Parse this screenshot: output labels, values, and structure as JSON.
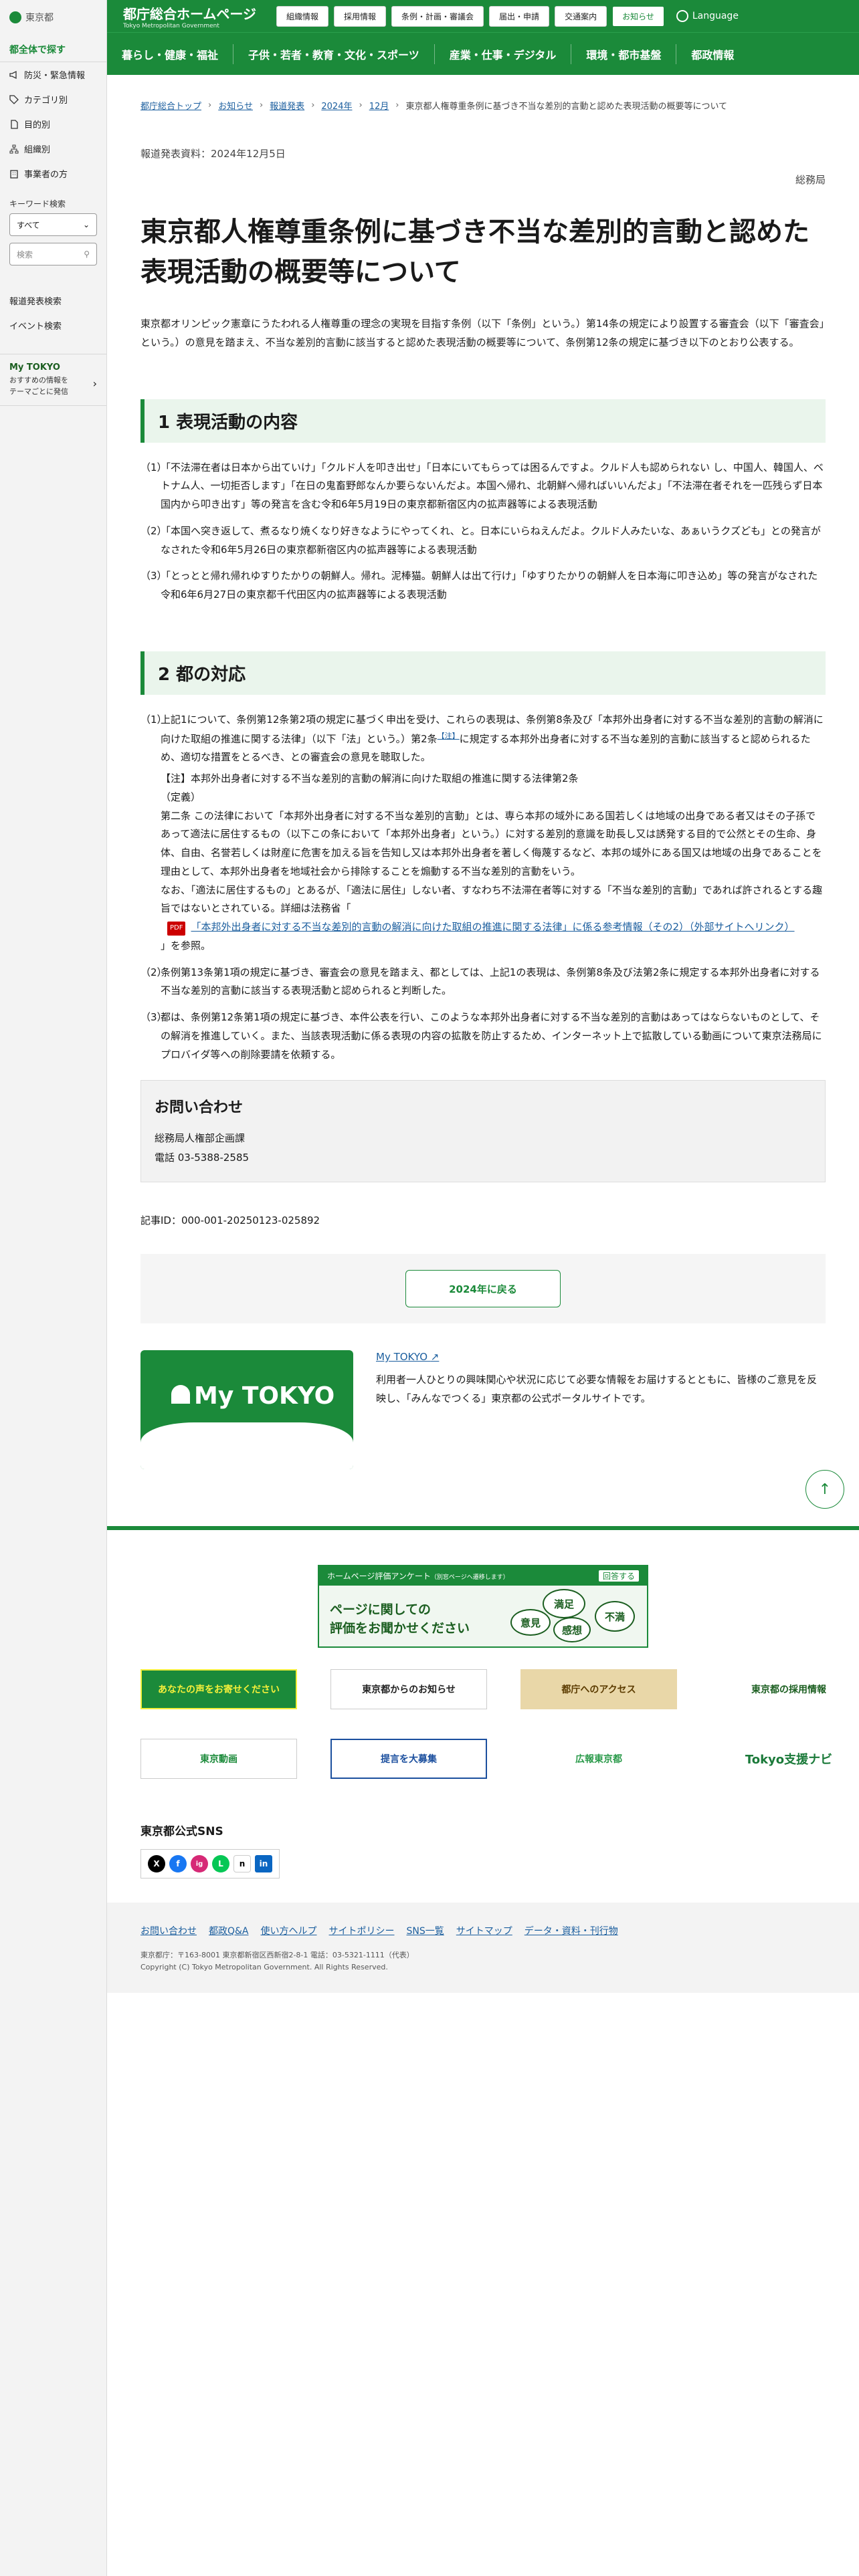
{
  "sidebar": {
    "logo": "東京都",
    "section_title": "都全体で探す",
    "items": [
      "防災・緊急情報",
      "カテゴリ別",
      "目的別",
      "組織別",
      "事業者の方"
    ],
    "keyword_label": "キーワード検索",
    "select_value": "すべて",
    "search_placeholder": "検索",
    "links": [
      "報道発表検索",
      "イベント検索"
    ],
    "mytokyo_title": "My TOKYO",
    "mytokyo_sub1": "おすすめの情報を",
    "mytokyo_sub2": "テーマごとに発信"
  },
  "header": {
    "title": "都庁総合ホームページ",
    "subtitle": "Tokyo Metropolitan Government",
    "top_links": [
      "組織情報",
      "採用情報",
      "条例・計画・審議会",
      "届出・申請",
      "交通案内",
      "お知らせ"
    ],
    "language": "Language",
    "nav": [
      "暮らし・健康・福祉",
      "子供・若者・教育・文化・スポーツ",
      "産業・仕事・デジタル",
      "環境・都市基盤",
      "都政情報"
    ]
  },
  "breadcrumb": [
    "都庁総合トップ",
    "お知らせ",
    "報道発表",
    "2024年",
    "12月",
    "東京都人権尊重条例に基づき不当な差別的言動と認めた表現活動の概要等について"
  ],
  "article": {
    "date": "報道発表資料：2024年12月5日",
    "bureau": "総務局",
    "title": "東京都人権尊重条例に基づき不当な差別的言動と認めた表現活動の概要等について",
    "lead": "東京都オリンピック憲章にうたわれる人権尊重の理念の実現を目指す条例（以下「条例」という。）第14条の規定により設置する審査会（以下「審査会」という。）の意見を踏まえ、不当な差別的言動に該当すると認めた表現活動の概要等について、条例第12条の規定に基づき以下のとおり公表する。",
    "section1": "1 表現活動の内容",
    "items1": [
      {
        "num": "（1）",
        "text": "「不法滞在者は日本から出ていけ」「クルド人を叩き出せ」「日本にいてもらっては困るんですよ。クルド人も認められない し、中国人、韓国人、ベトナム人、一切拒否します」「在日の鬼畜野郎なんか要らないんだよ。本国へ帰れ、北朝鮮へ帰ればいいんだよ」「不法滞在者それを一匹残らず日本国内から叩き出す」等の発言を含む令和6年5月19日の東京都新宿区内の拡声器等による表現活動"
      },
      {
        "num": "（2）",
        "text": "「本国へ突き返して、煮るなり焼くなり好きなようにやってくれ、と。日本にいらねえんだよ。クルド人みたいな、あぁいうクズども」との発言がなされた令和6年5月26日の東京都新宿区内の拡声器等による表現活動"
      },
      {
        "num": "（3）",
        "text": "「とっとと帰れ帰れゆすりたかりの朝鮮人。帰れ。泥棒猫。朝鮮人は出て行け」「ゆすりたかりの朝鮮人を日本海に叩き込め」等の発言がなされた令和6年6月27日の東京都千代田区内の拡声器等による表現活動"
      }
    ],
    "section2": "2 都の対応",
    "item2_1_num": "（1）",
    "item2_1_a": "上記1について、条例第12条第2項の規定に基づく申出を受け、これらの表現は、条例第8条及び「本邦外出身者に対する不当な差別的言動の解消に向けた取組の推進に関する法律」（以下「法」という。）第2条",
    "item2_1_ref": "【注】",
    "item2_1_b": "に規定する本邦外出身者に対する不当な差別的言動に該当すると認められるため、適切な措置をとるべき、との審査会の意見を聴取した。",
    "note_title": "【注】本邦外出身者に対する不当な差別的言動の解消に向けた取組の推進に関する法律第2条",
    "note_def": "（定義）",
    "note_body": "第二条 この法律において「本邦外出身者に対する不当な差別的言動」とは、専ら本邦の域外にある国若しくは地域の出身である者又はその子孫であって適法に居住するもの（以下この条において「本邦外出身者」という。）に対する差別的意識を助長し又は誘発する目的で公然とその生命、身体、自由、名誉若しくは財産に危害を加える旨を告知し又は本邦外出身者を著しく侮蔑するなど、本邦の域外にある国又は地域の出身であることを理由として、本邦外出身者を地域社会から排除することを煽動する不当な差別的言動をいう。",
    "note_extra": "なお、「適法に居住するもの」とあるが、「適法に居住」しない者、すなわち不法滞在者等に対する「不当な差別的言動」であれば許されるとする趣旨ではないとされている。詳細は法務省「",
    "pdf_badge": "PDF",
    "pdf_link": "「本邦外出身者に対する不当な差別的言動の解消に向けた取組の推進に関する法律」に係る参考情報（その2）（外部サイトへリンク）",
    "pdf_after": "」を参照。",
    "items2_rest": [
      {
        "num": "（2）",
        "text": "条例第13条第1項の規定に基づき、審査会の意見を踏まえ、都としては、上記1の表現は、条例第8条及び法第2条に規定する本邦外出身者に対する不当な差別的言動に該当する表現活動と認められると判断した。"
      },
      {
        "num": "（3）",
        "text": "都は、条例第12条第1項の規定に基づき、本件公表を行い、このような本邦外出身者に対する不当な差別的言動はあってはならないものとして、その解消を推進していく。また、当該表現活動に係る表現の内容の拡散を防止するため、インターネット上で拡散している動画について東京法務局にプロバイダ等への削除要請を依頼する。"
      }
    ],
    "contact_title": "お問い合わせ",
    "contact_lines": [
      "総務局人権部企画課",
      "電話 03-5388-2585"
    ],
    "article_id": "記事ID：000-001-20250123-025892",
    "back_button": "2024年に戻る",
    "mytokyo_link": "My TOKYO",
    "mytokyo_desc": "利用者一人ひとりの興味関心や状況に応じて必要な情報をお届けするとともに、皆様のご意見を反映し、「みんなでつくる」東京都の公式ポータルサイトです。",
    "mytokyo_img_text": "My TOKYO"
  },
  "footer": {
    "survey_head": "ホームページ評価アンケート",
    "survey_head_small": "（別窓ページへ遷移します）",
    "survey_btn": "回答する",
    "survey_line1": "ページに関しての",
    "survey_line2": "評価をお聞かせください",
    "bubbles": [
      "満足",
      "意見",
      "感想",
      "不満"
    ],
    "banners": [
      "あなたの声をお寄せください",
      "東京都からのお知らせ",
      "都庁へのアクセス",
      "東京都の採用情報",
      "東京動画",
      "提言を大募集",
      "広報東京都",
      "Tokyo支援ナビ"
    ],
    "sns_title": "東京都公式SNS",
    "sns": [
      "X",
      "f",
      "ig",
      "L",
      "n",
      "in"
    ],
    "links": [
      "お問い合わせ",
      "都政Q&A",
      "使い方ヘルプ",
      "サイトポリシー",
      "SNS一覧",
      "サイトマップ",
      "データ・資料・刊行物"
    ],
    "address": "東京都庁：〒163-8001 東京都新宿区西新宿2-8-1 電話：03-5321-1111（代表）",
    "copyright": "Copyright (C) Tokyo Metropolitan Government. All Rights Reserved."
  },
  "colors": {
    "brand": "#1b8a3a",
    "link": "#1b5e9e"
  }
}
